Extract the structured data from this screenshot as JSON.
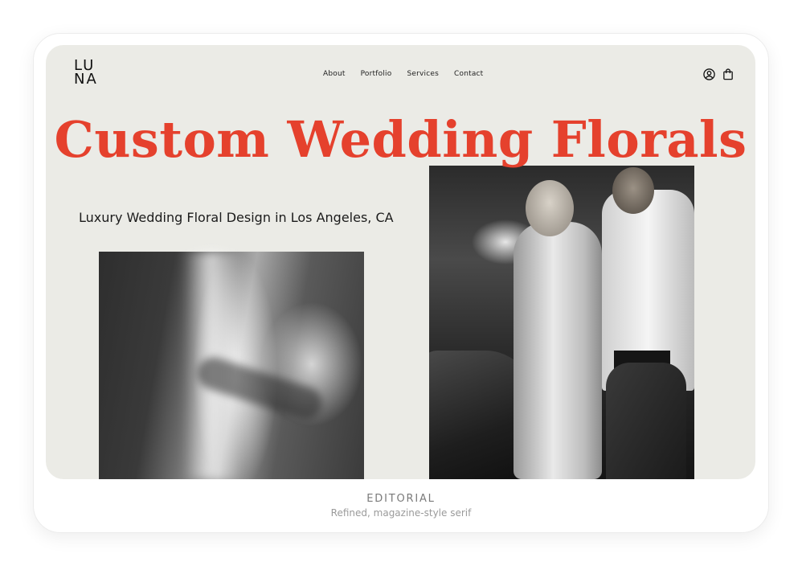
{
  "site": {
    "logo_top": "LU",
    "logo_bottom": "NA"
  },
  "nav": {
    "items": [
      {
        "label": "About"
      },
      {
        "label": "Portfolio"
      },
      {
        "label": "Services"
      },
      {
        "label": "Contact"
      }
    ]
  },
  "header_icons": {
    "account": "user-circle-icon",
    "cart": "shopping-bag-icon"
  },
  "hero": {
    "title": "Custom Wedding Florals",
    "subtitle": "Luxury Wedding Floral Design in Los Angeles, CA"
  },
  "caption": {
    "title": "EDITORIAL",
    "subtitle": "Refined, magazine-style serif"
  },
  "colors": {
    "accent": "#e5412d",
    "background": "#ebebe6"
  }
}
